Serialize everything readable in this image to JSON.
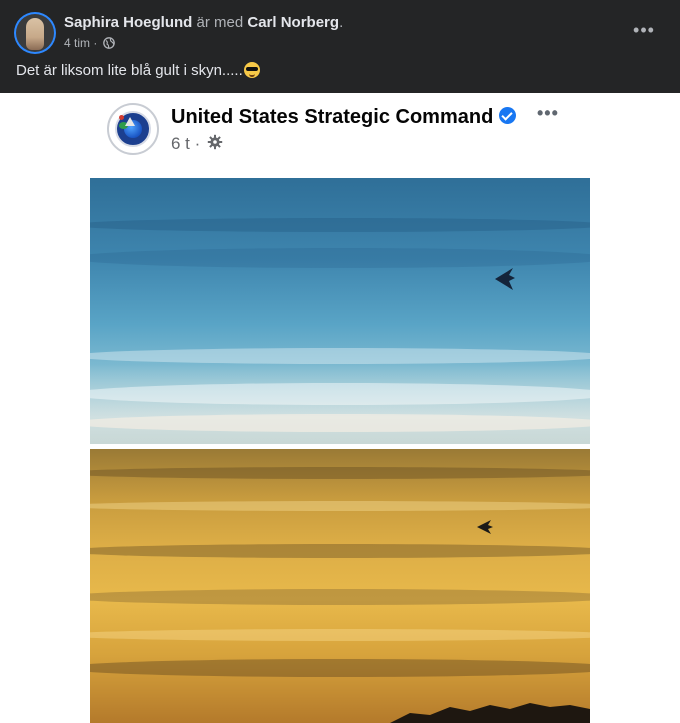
{
  "post": {
    "author": "Saphira Hoeglund",
    "with_text": "är med",
    "tagged": "Carl Norberg",
    "period": ".",
    "time": "4 tim",
    "separator": "·",
    "text": "Det är liksom lite blå gult i skyn.....",
    "more_label": "•••"
  },
  "shared": {
    "page_name": "United States Strategic Command",
    "time": "6 t",
    "separator": "·",
    "more_label": "•••"
  },
  "icons": {
    "globe": "globe-icon",
    "emoji": "sunglasses-emoji-icon",
    "verified": "verified-badge-icon",
    "gear": "gear-icon"
  },
  "colors": {
    "header_bg": "#242526",
    "header_text": "#e4e6eb",
    "muted_text": "#b0b3b8",
    "verified": "#1877f2",
    "card_bg": "#ffffff"
  }
}
